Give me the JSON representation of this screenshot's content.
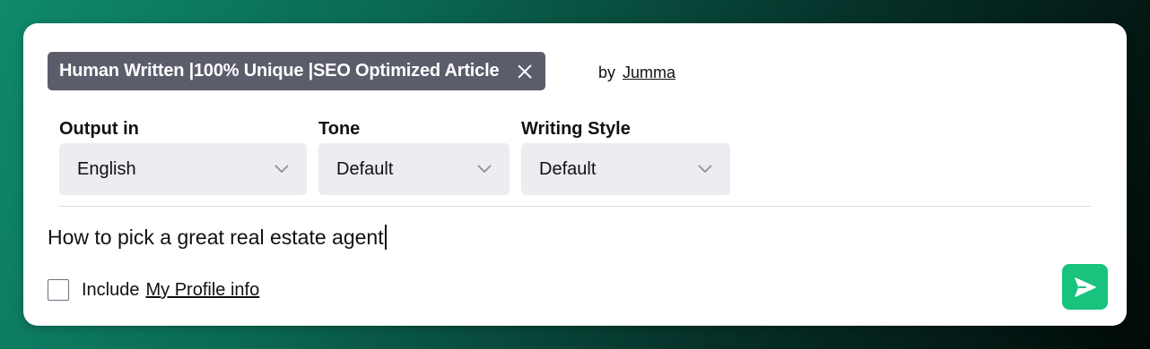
{
  "prompt_template": {
    "title": "Human Written |100% Unique |SEO Optimized Article",
    "by_label": "by",
    "author": "Jumma"
  },
  "options": {
    "output": {
      "label": "Output in",
      "value": "English"
    },
    "tone": {
      "label": "Tone",
      "value": "Default"
    },
    "writing_style": {
      "label": "Writing Style",
      "value": "Default"
    }
  },
  "prompt_input": {
    "value": "How to pick a great real estate agent"
  },
  "include_profile": {
    "checked": false,
    "label": "Include",
    "link": "My Profile info"
  },
  "colors": {
    "chip_bg": "#5b5d6b",
    "select_bg": "#ececf1",
    "send_button": "#19c37d"
  },
  "icons": {
    "close": "close-icon",
    "dropdown": "chevron-down-icon",
    "send": "send-icon"
  }
}
